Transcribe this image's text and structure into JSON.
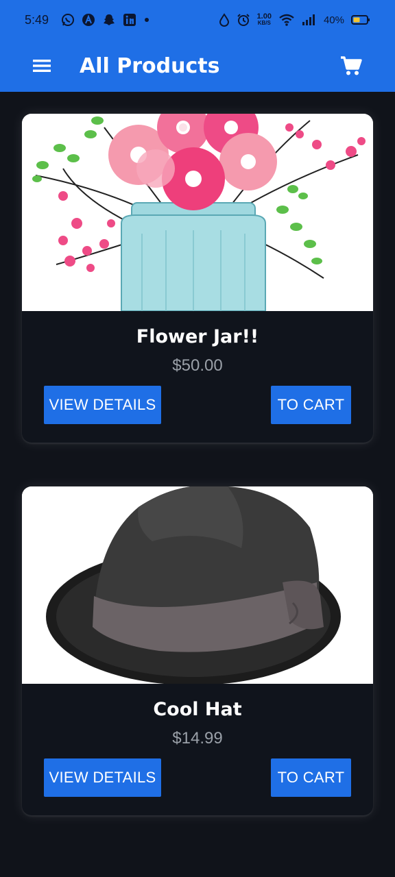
{
  "status_bar": {
    "time": "5:49",
    "speed_value": "1.00",
    "speed_unit": "KB/S",
    "battery": "40%"
  },
  "toolbar": {
    "title": "All Products"
  },
  "products": [
    {
      "name": "Flower Jar!!",
      "price": "$50.00",
      "details_label": "VIEW DETAILS",
      "cart_label": "TO CART"
    },
    {
      "name": "Cool Hat",
      "price": "$14.99",
      "details_label": "VIEW DETAILS",
      "cart_label": "TO CART"
    }
  ],
  "colors": {
    "app_bar": "#1f6fe6",
    "background": "#10131a",
    "card": "#10141c",
    "price": "#9aa0a8"
  }
}
